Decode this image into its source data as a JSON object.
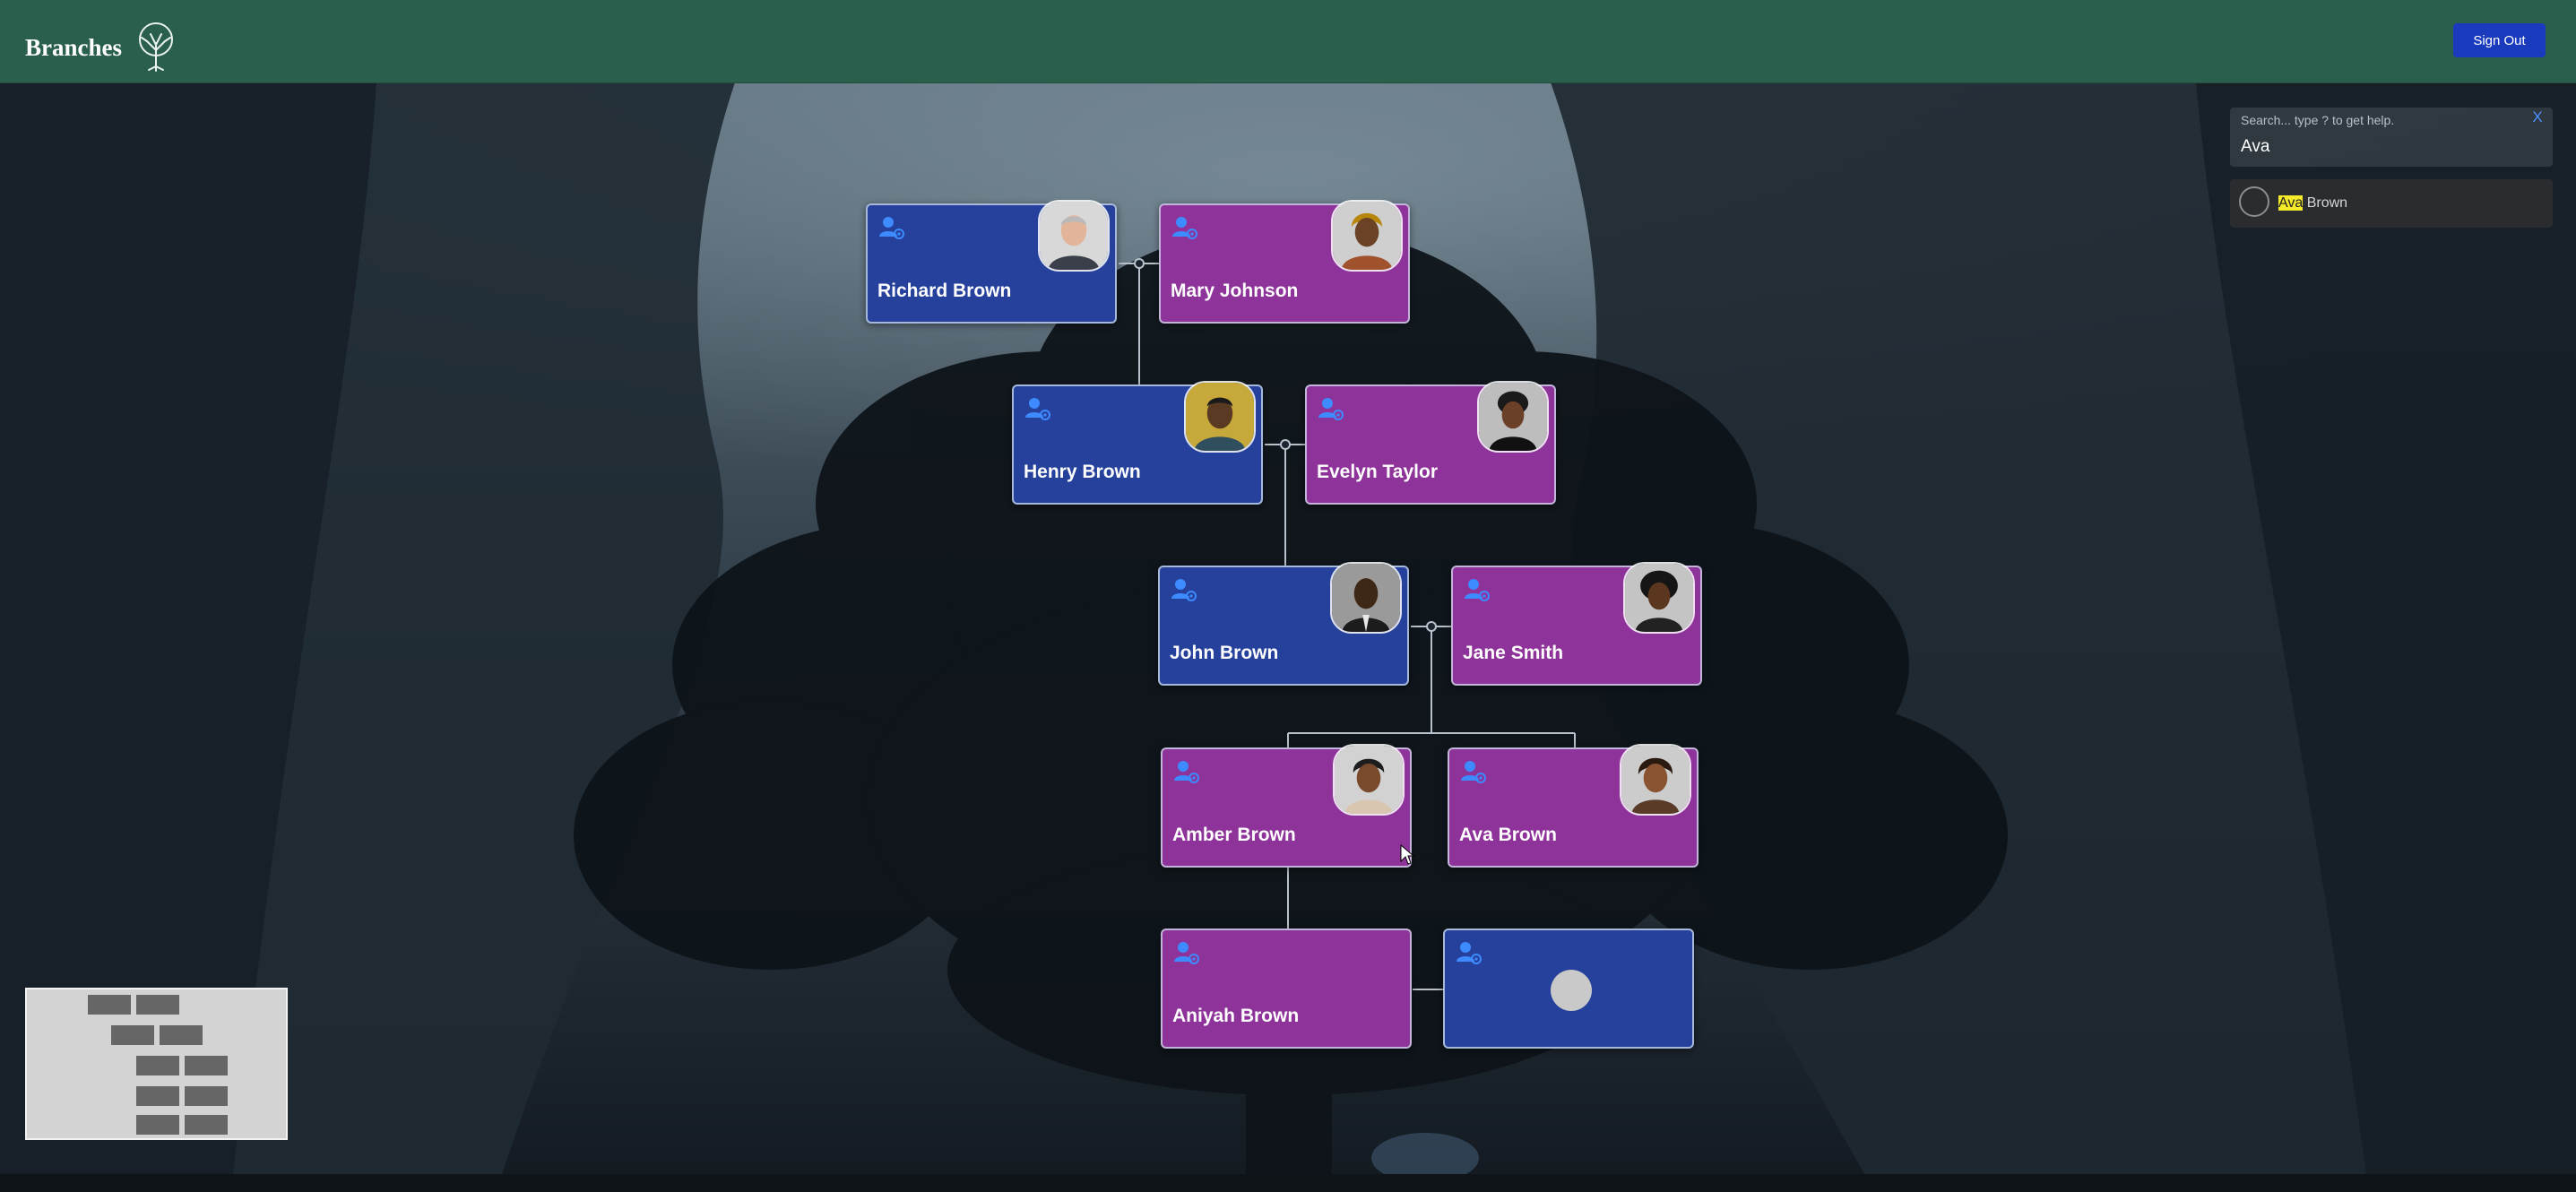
{
  "header": {
    "brand": "Branches",
    "logo_icon": "tree-icon",
    "sign_out_label": "Sign Out",
    "background_color": "#2a5f4d"
  },
  "search": {
    "hint": "Search... type ? to get help.",
    "value": "Ava",
    "close_label": "X",
    "result": {
      "highlight": "Ava",
      "rest": " Brown"
    }
  },
  "tree": {
    "colors": {
      "male": "#26419c",
      "female": "#8e3399"
    },
    "people": [
      {
        "name": "Richard Brown",
        "gender": "male"
      },
      {
        "name": "Mary Johnson",
        "gender": "female"
      },
      {
        "name": "Henry Brown",
        "gender": "male"
      },
      {
        "name": "Evelyn Taylor",
        "gender": "female"
      },
      {
        "name": "John Brown",
        "gender": "male"
      },
      {
        "name": "Jane Smith",
        "gender": "female"
      },
      {
        "name": "Amber Brown",
        "gender": "female"
      },
      {
        "name": "Ava Brown",
        "gender": "female"
      },
      {
        "name": "Aniyah Brown",
        "gender": "female"
      },
      {
        "name": "",
        "gender": "male"
      }
    ]
  }
}
